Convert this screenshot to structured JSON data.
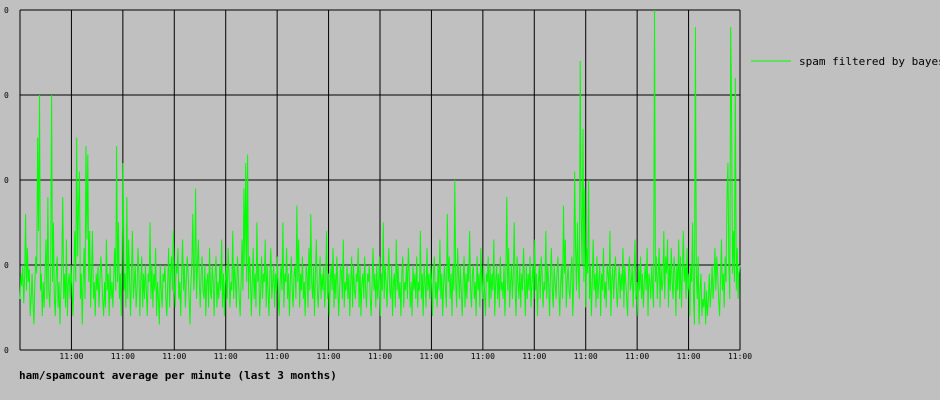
{
  "chart_data": {
    "type": "line",
    "title": "ham/spamcount average per minute (last 3 months)",
    "xlabel": "",
    "ylabel": "",
    "grid": true,
    "legend_position": "top-right",
    "colors": {
      "background": "#c0c0c0",
      "grid": "#000000",
      "series": "#00ff00"
    },
    "x_ticks": [
      "11:00",
      "11:00",
      "11:00",
      "11:00",
      "11:00",
      "11:00",
      "11:00",
      "11:00",
      "11:00",
      "11:00",
      "11:00",
      "11:00",
      "11:00",
      "11:00",
      "11:00"
    ],
    "y_ticks": [
      "0",
      "0",
      "0",
      "0",
      "0"
    ],
    "ylim": [
      0,
      4
    ],
    "series": [
      {
        "name": "spam filtered by bayes",
        "values": [
          0.6,
          0.9,
          0.75,
          1.0,
          0.55,
          0.85,
          1.6,
          0.7,
          1.2,
          0.8,
          0.95,
          0.4,
          0.6,
          0.9,
          0.55,
          0.3,
          0.8,
          1.1,
          0.9,
          2.5,
          1.4,
          3.0,
          0.7,
          0.9,
          0.4,
          0.8,
          0.5,
          0.9,
          1.3,
          0.6,
          1.8,
          0.7,
          0.5,
          0.9,
          3.0,
          0.8,
          1.5,
          0.6,
          0.4,
          0.9,
          1.1,
          0.5,
          0.8,
          0.3,
          0.7,
          1.0,
          1.8,
          0.6,
          0.9,
          0.5,
          1.3,
          0.4,
          0.8,
          0.9,
          0.6,
          1.0,
          0.7,
          0.4,
          0.9,
          1.4,
          0.8,
          2.5,
          1.1,
          1.7,
          2.1,
          0.6,
          0.9,
          0.3,
          0.8,
          1.2,
          0.6,
          2.4,
          1.3,
          2.3,
          0.8,
          1.4,
          0.5,
          0.9,
          1.4,
          0.6,
          0.8,
          0.4,
          0.9,
          0.7,
          1.0,
          0.5,
          0.8,
          1.1,
          0.9,
          0.6,
          0.4,
          0.8,
          0.5,
          1.3,
          0.7,
          0.9,
          0.4,
          1.0,
          0.6,
          0.8,
          0.5,
          0.9,
          1.2,
          0.7,
          2.4,
          0.8,
          1.5,
          0.6,
          0.9,
          0.4,
          1.1,
          2.2,
          0.7,
          0.9,
          0.5,
          1.8,
          0.6,
          1.3,
          0.8,
          0.4,
          0.9,
          1.4,
          0.6,
          0.8,
          1.0,
          0.5,
          0.7,
          1.2,
          0.9,
          0.4,
          0.8,
          1.1,
          0.5,
          0.9,
          0.6,
          1.0,
          0.7,
          0.4,
          0.9,
          0.8,
          1.5,
          0.6,
          1.0,
          0.5,
          0.9,
          0.7,
          1.2,
          0.4,
          0.8,
          0.6,
          0.3,
          1.0,
          0.7,
          0.5,
          0.9,
          0.8,
          1.0,
          0.6,
          0.4,
          0.8,
          1.2,
          0.5,
          0.9,
          1.1,
          0.7,
          1.4,
          0.8,
          0.5,
          1.0,
          0.9,
          1.2,
          0.6,
          0.8,
          0.4,
          0.9,
          1.3,
          0.7,
          1.0,
          0.5,
          0.8,
          1.1,
          0.9,
          0.6,
          0.3,
          0.8,
          1.0,
          1.6,
          0.7,
          0.9,
          1.9,
          0.6,
          1.0,
          1.3,
          0.8,
          0.5,
          0.9,
          1.1,
          0.7,
          0.6,
          1.0,
          0.4,
          0.8,
          0.9,
          0.5,
          1.2,
          0.7,
          0.6,
          1.0,
          0.8,
          0.4,
          0.9,
          1.1,
          0.5,
          0.8,
          0.6,
          1.0,
          0.7,
          1.3,
          0.5,
          0.9,
          0.4,
          0.8,
          1.0,
          0.6,
          1.2,
          0.9,
          0.5,
          0.8,
          0.7,
          1.4,
          0.6,
          1.0,
          0.8,
          0.5,
          1.1,
          0.9,
          0.6,
          0.4,
          0.8,
          1.3,
          0.7,
          1.9,
          1.0,
          2.2,
          0.8,
          2.3,
          0.6,
          1.1,
          0.9,
          0.4,
          0.8,
          1.2,
          0.6,
          0.9,
          0.5,
          1.5,
          0.8,
          1.0,
          0.4,
          0.7,
          1.1,
          0.6,
          0.9,
          0.8,
          1.3,
          0.5,
          1.0,
          0.7,
          0.4,
          0.9,
          1.2,
          0.6,
          0.8,
          1.0,
          0.5,
          0.9,
          0.7,
          1.1,
          0.6,
          0.4,
          0.8,
          1.0,
          0.7,
          1.5,
          0.5,
          0.9,
          0.8,
          1.2,
          0.6,
          0.9,
          0.4,
          0.8,
          1.1,
          0.7,
          0.5,
          0.9,
          1.0,
          0.6,
          1.7,
          0.8,
          1.3,
          0.5,
          0.9,
          0.7,
          1.1,
          0.6,
          0.8,
          0.4,
          1.0,
          0.9,
          0.5,
          1.2,
          0.7,
          1.6,
          0.8,
          0.6,
          1.0,
          0.4,
          0.9,
          1.3,
          0.7,
          0.5,
          0.8,
          1.1,
          0.6,
          0.9,
          0.7,
          1.0,
          0.5,
          0.8,
          1.4,
          0.6,
          0.9,
          0.4,
          0.8,
          1.0,
          0.7,
          1.2,
          0.5,
          0.9,
          0.6,
          1.1,
          0.8,
          0.4,
          0.7,
          1.0,
          0.9,
          0.6,
          1.3,
          0.5,
          0.8,
          0.7,
          1.0,
          0.6,
          0.9,
          0.4,
          0.8,
          1.1,
          0.5,
          1.0,
          0.7,
          0.6,
          0.9,
          0.8,
          1.2,
          0.5,
          1.0,
          0.4,
          0.8,
          0.9,
          0.6,
          1.1,
          0.7,
          0.5,
          0.9,
          0.8,
          1.0,
          0.6,
          0.4,
          0.8,
          1.2,
          0.7,
          0.9,
          0.5,
          1.0,
          0.6,
          0.8,
          1.1,
          0.4,
          0.9,
          0.7,
          1.5,
          0.6,
          1.0,
          0.8,
          0.5,
          0.9,
          1.2,
          0.7,
          0.6,
          1.0,
          0.4,
          0.8,
          0.9,
          0.5,
          1.3,
          0.7,
          1.0,
          0.6,
          0.8,
          0.4,
          0.9,
          1.1,
          0.5,
          0.8,
          0.7,
          1.0,
          0.6,
          1.2,
          0.9,
          0.5,
          0.8,
          0.4,
          1.0,
          0.7,
          0.9,
          0.6,
          1.1,
          0.5,
          0.8,
          0.7,
          1.4,
          0.6,
          0.9,
          0.4,
          1.0,
          0.8,
          0.5,
          1.2,
          0.7,
          0.9,
          0.6,
          1.0,
          0.8,
          0.4,
          0.9,
          1.1,
          0.6,
          0.8,
          0.5,
          1.0,
          0.7,
          1.3,
          0.6,
          0.9,
          0.4,
          0.8,
          1.0,
          0.7,
          0.5,
          1.6,
          0.8,
          1.1,
          0.6,
          0.9,
          0.4,
          1.0,
          0.7,
          2.0,
          0.8,
          0.5,
          1.2,
          0.9,
          0.6,
          1.0,
          0.7,
          0.4,
          0.8,
          1.1,
          0.5,
          0.9,
          0.6,
          1.0,
          0.8,
          1.4,
          0.7,
          0.5,
          0.9,
          1.0,
          0.6,
          0.8,
          0.4,
          1.1,
          0.7,
          0.9,
          0.5,
          1.2,
          0.8,
          0.6,
          1.0,
          0.7,
          0.4,
          0.9,
          0.8,
          1.1,
          0.5,
          1.0,
          0.6,
          0.9,
          0.7,
          1.3,
          0.4,
          0.8,
          1.0,
          0.6,
          0.9,
          0.5,
          1.1,
          0.7,
          0.8,
          0.6,
          1.0,
          0.4,
          0.9,
          1.8,
          0.7,
          1.2,
          0.5,
          0.8,
          1.0,
          0.6,
          0.9,
          1.5,
          0.7,
          0.4,
          1.1,
          0.8,
          0.6,
          1.0,
          0.5,
          0.9,
          0.7,
          1.2,
          0.8,
          0.4,
          1.0,
          0.6,
          0.9,
          0.7,
          1.1,
          0.5,
          0.8,
          1.0,
          0.6,
          1.3,
          0.7,
          0.9,
          0.4,
          0.8,
          1.0,
          0.6,
          1.1,
          0.9,
          0.5,
          0.8,
          0.7,
          1.4,
          0.6,
          1.0,
          0.8,
          0.4,
          0.9,
          1.2,
          0.7,
          0.5,
          1.0,
          0.8,
          0.6,
          0.9,
          1.1,
          0.7,
          0.4,
          0.8,
          1.0,
          0.6,
          1.7,
          0.9,
          1.3,
          0.5,
          0.8,
          1.0,
          0.7,
          0.6,
          0.9,
          1.1,
          0.4,
          0.8,
          2.1,
          1.2,
          0.7,
          1.5,
          0.9,
          0.6,
          3.4,
          1.6,
          1.0,
          2.6,
          0.8,
          1.9,
          0.5,
          1.2,
          0.9,
          2.0,
          0.6,
          1.0,
          0.4,
          0.8,
          1.3,
          0.7,
          0.9,
          0.5,
          1.1,
          0.6,
          0.8,
          1.0,
          0.4,
          0.9,
          0.7,
          1.2,
          0.6,
          0.8,
          0.5,
          1.0,
          0.9,
          0.7,
          1.4,
          0.4,
          0.8,
          1.0,
          0.6,
          0.9,
          1.1,
          0.7,
          0.5,
          0.8,
          1.0,
          0.6,
          0.9,
          0.7,
          1.2,
          0.5,
          1.0,
          0.8,
          0.6,
          0.4,
          0.9,
          1.1,
          0.7,
          0.8,
          1.0,
          0.5,
          0.9,
          1.3,
          0.6,
          0.8,
          0.4,
          1.0,
          0.7,
          1.1,
          0.6,
          0.9,
          0.5,
          0.8,
          1.0,
          0.7,
          1.2,
          0.4,
          0.9,
          0.8,
          0.6,
          1.0,
          0.7,
          0.5,
          4.0,
          0.8,
          1.1,
          0.6,
          0.9,
          1.2,
          0.5,
          1.0,
          0.7,
          0.8,
          1.4,
          0.6,
          1.1,
          0.9,
          1.3,
          0.5,
          1.0,
          0.7,
          1.2,
          0.8,
          0.6,
          1.1,
          0.9,
          0.4,
          1.0,
          0.7,
          1.3,
          0.6,
          1.1,
          0.5,
          0.9,
          1.4,
          0.8,
          1.0,
          0.6,
          1.2,
          0.7,
          0.9,
          0.4,
          1.0,
          0.8,
          1.5,
          0.6,
          0.3,
          3.8,
          0.9,
          0.6,
          1.1,
          0.3,
          0.7,
          0.9,
          0.4,
          0.6,
          0.5,
          0.8,
          0.3,
          0.7,
          0.4,
          0.6,
          0.9,
          0.5,
          0.7,
          1.0,
          0.6,
          0.8,
          1.2,
          0.7,
          1.1,
          0.9,
          0.6,
          0.4,
          0.8,
          1.3,
          0.7,
          0.9,
          0.5,
          1.1,
          0.8,
          1.8,
          2.2,
          1.0,
          0.6,
          3.8,
          2.7,
          0.9,
          1.4,
          0.8,
          3.2,
          0.7,
          1.2,
          0.6,
          0.9,
          1.0
        ]
      }
    ]
  }
}
